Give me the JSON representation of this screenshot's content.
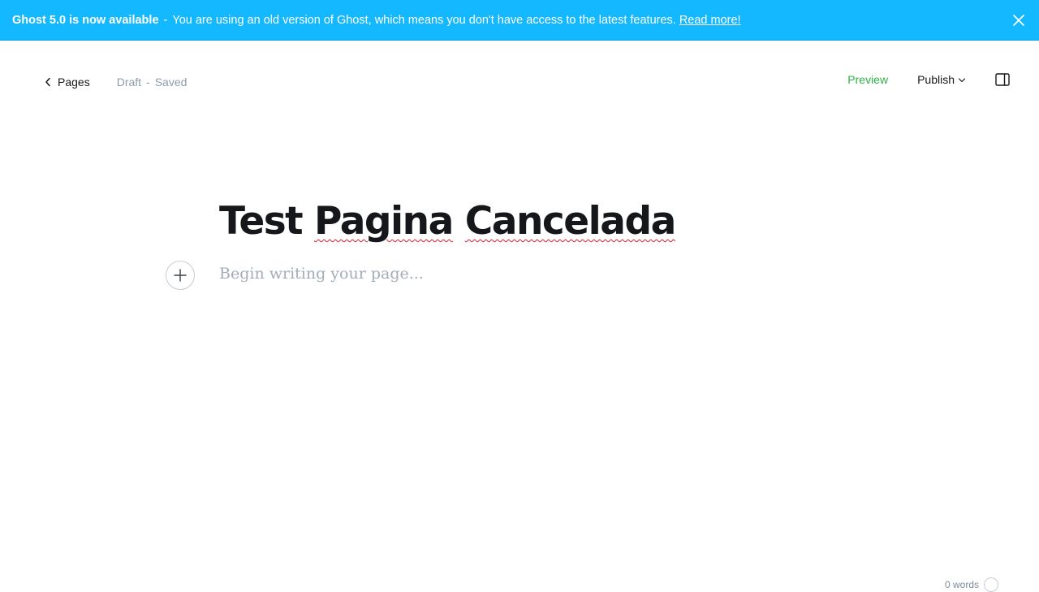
{
  "banner": {
    "headline": "Ghost 5.0 is now available",
    "separator": "-",
    "message": "You are using an old version of Ghost, which means you don't have access to the latest features.",
    "link_label": "Read more!",
    "close_icon": "close-icon",
    "background_color": "#14b8ff"
  },
  "editor_header": {
    "back_label": "Pages",
    "back_icon": "chevron-left-icon",
    "status_state": "Draft",
    "status_separator": "-",
    "status_saved": "Saved",
    "preview_label": "Preview",
    "publish_label": "Publish",
    "publish_icon": "chevron-down-icon",
    "sidebar_icon": "sidebar-toggle-icon",
    "accent_color": "#2fb344"
  },
  "editor": {
    "title_word1": "Test",
    "title_word2": "Pagina",
    "title_word3": "Cancelada",
    "body_placeholder": "Begin writing your page...",
    "add_card_icon": "plus-icon"
  },
  "footer": {
    "word_count": "0 words"
  }
}
